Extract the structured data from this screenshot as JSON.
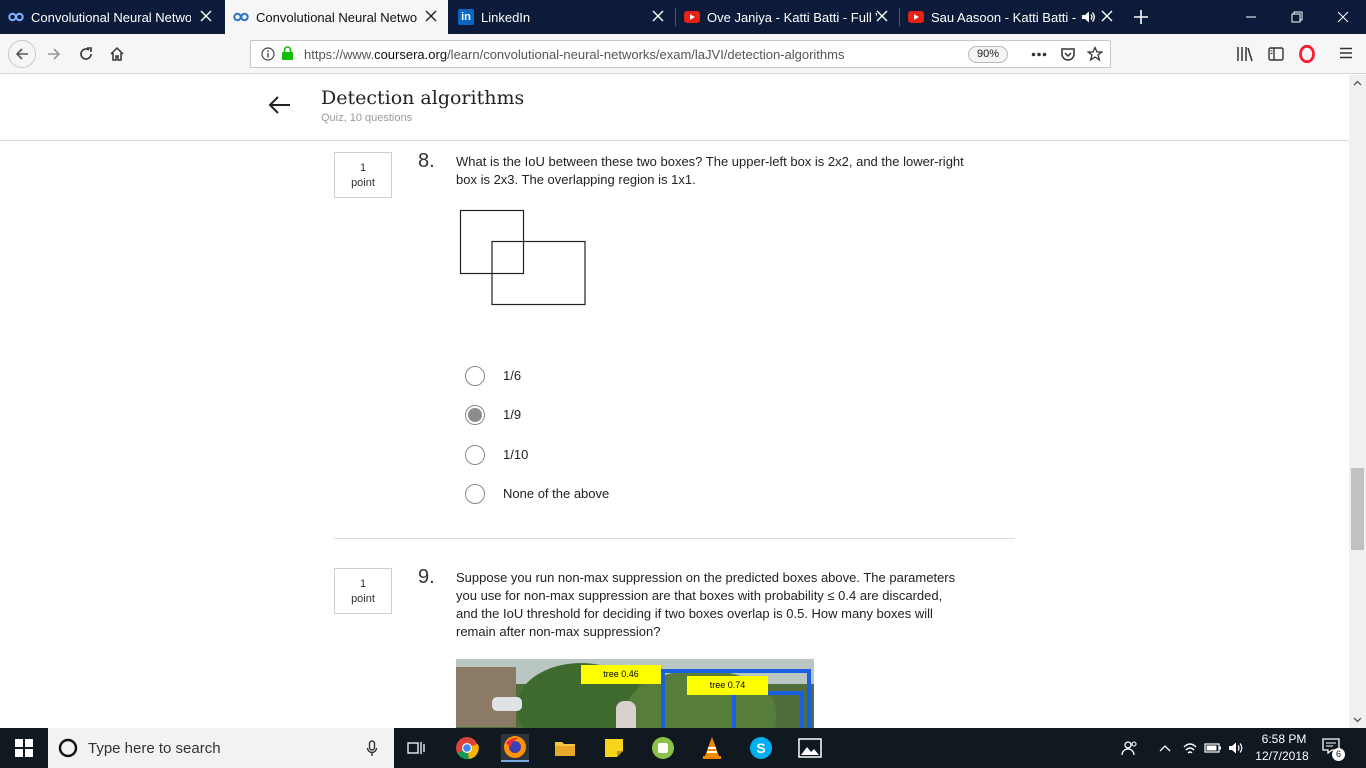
{
  "browser": {
    "tabs": [
      {
        "label": "Convolutional Neural Network",
        "icon": "coursera-icon",
        "active": false
      },
      {
        "label": "Convolutional Neural Network",
        "icon": "coursera-icon",
        "active": true
      },
      {
        "label": "LinkedIn",
        "icon": "linkedin-icon",
        "active": false
      },
      {
        "label": "Ove Janiya - Katti Batti - Full Vi",
        "icon": "youtube-icon",
        "active": false
      },
      {
        "label": "Sau Aasoon - Katti Batti - Fu",
        "icon": "youtube-icon",
        "active": false
      }
    ],
    "url_prefix": "https://www.",
    "url_domain": "coursera.org",
    "url_path": "/learn/convolutional-neural-networks/exam/laJVI/detection-algorithms",
    "zoom": "90%",
    "accent_color": "#0c1b3a"
  },
  "quiz": {
    "title": "Detection algorithms",
    "subtitle": "Quiz, 10 questions"
  },
  "questions": [
    {
      "number": "8.",
      "points_value": "1",
      "points_label": "point",
      "text_line1": "What is the IoU between these two boxes? The upper-left box is 2x2, and the lower-right",
      "text_line2": "box is 2x3. The overlapping region is 1x1.",
      "options": [
        "1/6",
        "1/9",
        "1/10",
        "None of the above"
      ],
      "selected_option": "1/9"
    },
    {
      "number": "9.",
      "points_value": "1",
      "points_label": "point",
      "text_line1": "Suppose you run non-max suppression on the predicted boxes above. The parameters",
      "text_line2": "you use for non-max suppression are that boxes with probability ≤ 0.4 are discarded,",
      "text_line3": "and the IoU threshold for deciding if two boxes overlap is 0.5. How many boxes will",
      "text_line4": "remain after non-max suppression?",
      "image_labels": [
        "tree 0.46",
        "tree 0.74"
      ]
    }
  ],
  "taskbar": {
    "search_placeholder": "Type here to search",
    "time": "6:58 PM",
    "date": "12/7/2018",
    "notification_count": "6"
  }
}
